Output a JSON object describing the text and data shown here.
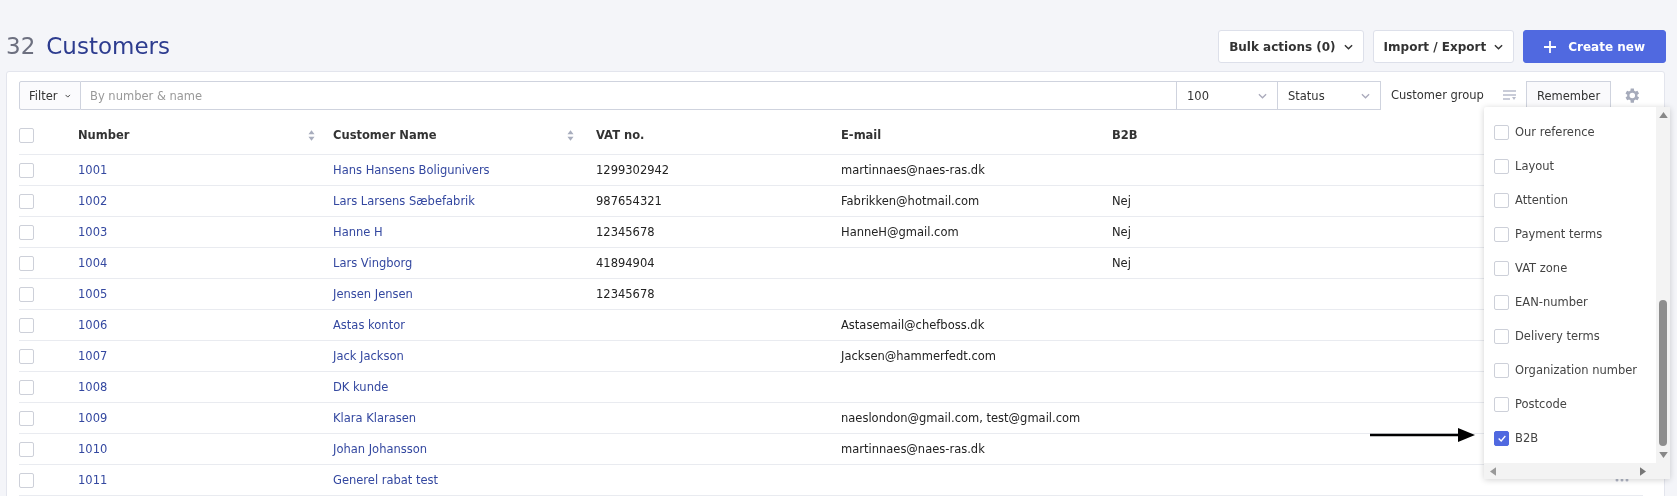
{
  "header": {
    "count": "32",
    "title": "Customers",
    "buttons": [
      {
        "label": "Bulk actions (0)",
        "kind": "dropdown"
      },
      {
        "label": "Import / Export",
        "kind": "dropdown"
      },
      {
        "label": "Create new",
        "kind": "primary"
      }
    ]
  },
  "filter_bar": {
    "filter_button": "Filter",
    "search": {
      "placeholder": "By number & name"
    },
    "page_size": "100",
    "status": "Status",
    "customer_group": "Customer group",
    "remember_button": "Remember"
  },
  "table": {
    "select_all_checked": false,
    "columns": [
      {
        "label": "Number",
        "sortable": true
      },
      {
        "label": "Customer Name",
        "sortable": true
      },
      {
        "label": "VAT no.",
        "sortable": false
      },
      {
        "label": "E-mail",
        "sortable": false
      },
      {
        "label": "B2B",
        "sortable": false
      }
    ],
    "rows": [
      {
        "checked": false,
        "number": "1001",
        "name": "Hans Hansens Boligunivers",
        "vat": "1299302942",
        "email": "martinnaes@naes-ras.dk",
        "b2b": ""
      },
      {
        "checked": false,
        "number": "1002",
        "name": "Lars Larsens Sæbefabrik",
        "vat": "987654321",
        "email": "Fabrikken@hotmail.com",
        "b2b": "Nej"
      },
      {
        "checked": false,
        "number": "1003",
        "name": "Hanne H",
        "vat": "12345678",
        "email": "HanneH@gmail.com",
        "b2b": "Nej"
      },
      {
        "checked": false,
        "number": "1004",
        "name": "Lars Vingborg",
        "vat": "41894904",
        "email": "",
        "b2b": "Nej"
      },
      {
        "checked": false,
        "number": "1005",
        "name": "Jensen Jensen",
        "vat": "12345678",
        "email": "",
        "b2b": ""
      },
      {
        "checked": false,
        "number": "1006",
        "name": "Astas kontor",
        "vat": "",
        "email": "Astasemail@chefboss.dk",
        "b2b": ""
      },
      {
        "checked": false,
        "number": "1007",
        "name": "Jack Jackson",
        "vat": "",
        "email": "Jacksen@hammerfedt.com",
        "b2b": ""
      },
      {
        "checked": false,
        "number": "1008",
        "name": "DK kunde",
        "vat": "",
        "email": "",
        "b2b": ""
      },
      {
        "checked": false,
        "number": "1009",
        "name": "Klara Klarasen",
        "vat": "",
        "email": "naeslondon@gmail.com, test@gmail.com",
        "b2b": ""
      },
      {
        "checked": false,
        "number": "1010",
        "name": "Johan Johansson",
        "vat": "",
        "email": "martinnaes@naes-ras.dk",
        "b2b": ""
      },
      {
        "checked": false,
        "number": "1011",
        "name": "Generel rabat test",
        "vat": "",
        "email": "",
        "b2b": "",
        "more": true
      }
    ]
  },
  "column_menu": {
    "items": [
      {
        "label": "Our reference",
        "checked": false
      },
      {
        "label": "Layout",
        "checked": false
      },
      {
        "label": "Attention",
        "checked": false
      },
      {
        "label": "Payment terms",
        "checked": false
      },
      {
        "label": "VAT zone",
        "checked": false
      },
      {
        "label": "EAN-number",
        "checked": false
      },
      {
        "label": "Delivery terms",
        "checked": false
      },
      {
        "label": "Organization number",
        "checked": false
      },
      {
        "label": "Postcode",
        "checked": false
      },
      {
        "label": "B2B",
        "checked": true
      }
    ]
  }
}
